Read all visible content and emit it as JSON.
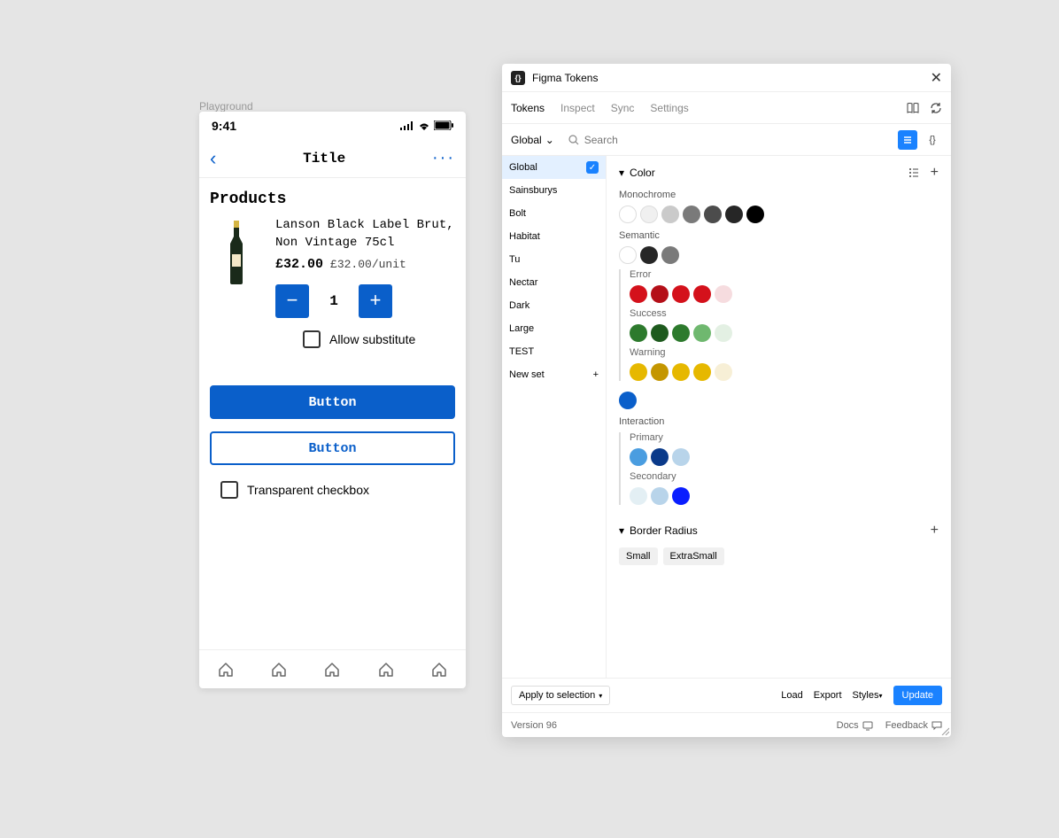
{
  "playground_label": "Playground",
  "phone": {
    "time": "9:41",
    "nav_title": "Title",
    "section_title": "Products",
    "product": {
      "name": "Lanson Black Label Brut, Non Vintage 75cl",
      "price": "£32.00",
      "unit_price": "£32.00/unit",
      "quantity": "1",
      "allow_substitute_label": "Allow substitute"
    },
    "button_primary": "Button",
    "button_secondary": "Button",
    "transparent_checkbox_label": "Transparent checkbox"
  },
  "tokens": {
    "header_title": "Figma Tokens",
    "tabs": {
      "tokens": "Tokens",
      "inspect": "Inspect",
      "sync": "Sync",
      "settings": "Settings"
    },
    "dropdown_label": "Global",
    "search_placeholder": "Search",
    "sidebar": {
      "items": [
        {
          "label": "Global",
          "active": true,
          "checked": true
        },
        {
          "label": "Sainsburys"
        },
        {
          "label": "Bolt"
        },
        {
          "label": "Habitat"
        },
        {
          "label": "Tu"
        },
        {
          "label": "Nectar"
        },
        {
          "label": "Dark"
        },
        {
          "label": "Large"
        },
        {
          "label": "TEST"
        }
      ],
      "new_set": "New set"
    },
    "color_section": "Color",
    "groups": {
      "monochrome": {
        "label": "Monochrome",
        "swatches": [
          "#ffffff",
          "#f0f0f0",
          "#cacaca",
          "#7a7a7a",
          "#4c4c4c",
          "#262626",
          "#000000"
        ]
      },
      "semantic": {
        "label": "Semantic",
        "swatches": [
          "#ffffff",
          "#262626",
          "#7a7a7a"
        ],
        "error": {
          "label": "Error",
          "swatches": [
            "#d4111b",
            "#b40f18",
            "#d4111b",
            "#d4111b",
            "#f6dcdf"
          ]
        },
        "success": {
          "label": "Success",
          "swatches": [
            "#2d7a2d",
            "#1e5a1e",
            "#2d7a2d",
            "#6fb86f",
            "#e3f0e3"
          ]
        },
        "warning": {
          "label": "Warning",
          "swatches": [
            "#e6b800",
            "#c49600",
            "#e6b800",
            "#e6b800",
            "#f7efd6"
          ]
        },
        "blue_lone": "#0a5fca"
      },
      "interaction": {
        "label": "Interaction",
        "primary": {
          "label": "Primary",
          "swatches": [
            "#4a9de0",
            "#0a3a8a",
            "#b8d4ea"
          ]
        },
        "secondary": {
          "label": "Secondary",
          "swatches": [
            "#e3eff4",
            "#b8d4ea",
            "#0a1eff"
          ]
        }
      }
    },
    "border_radius_section": "Border Radius",
    "chips": {
      "small": "Small",
      "extrasmall": "ExtraSmall"
    },
    "footer": {
      "apply": "Apply to selection",
      "load": "Load",
      "export": "Export",
      "styles": "Styles",
      "update": "Update"
    },
    "version": "Version 96",
    "docs": "Docs",
    "feedback": "Feedback"
  }
}
